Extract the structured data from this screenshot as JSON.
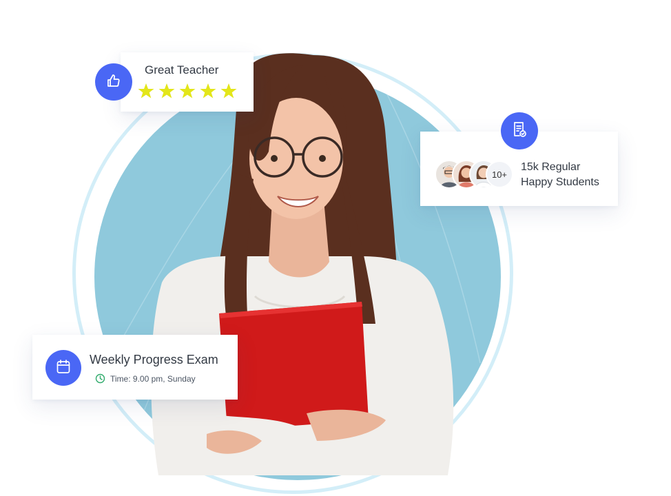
{
  "rating_card": {
    "title": "Great Teacher",
    "rating": 5,
    "max_rating": 5,
    "icon": "thumbs-up-icon",
    "star_color": "#e3e61a"
  },
  "students_card": {
    "icon": "certificate-icon",
    "more_label": "10+",
    "line1": "15k Regular",
    "line2": "Happy Students"
  },
  "exam_card": {
    "icon": "calendar-icon",
    "title": "Weekly Progress Exam",
    "time_icon": "clock-icon",
    "time": "Time: 9.00 pm, Sunday"
  },
  "colors": {
    "accent": "#4a67f5",
    "circle": "#8fc9dc",
    "ring": "#d3eef8",
    "clock": "#2faa6b"
  }
}
